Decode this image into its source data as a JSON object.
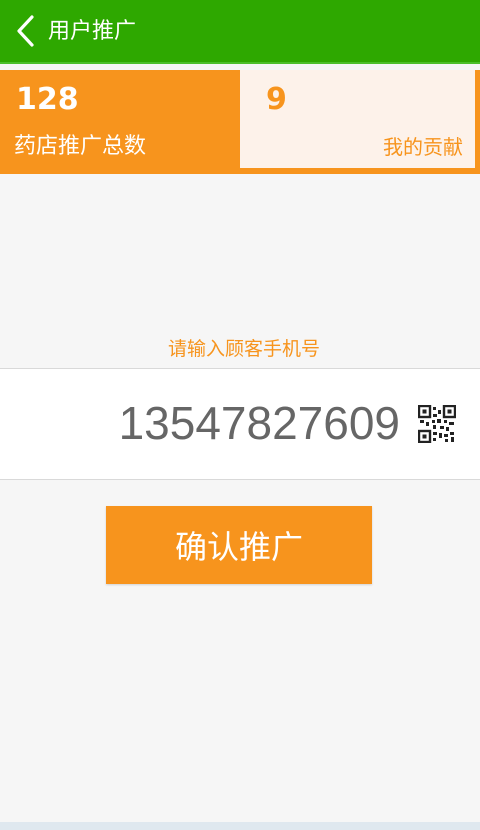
{
  "header": {
    "back_icon": "chevron-left-icon",
    "title": "用户推广"
  },
  "stats": {
    "store_total_value": "128",
    "store_total_label": "药店推广总数",
    "my_contribution_value": "9",
    "my_contribution_label": "我的贡献"
  },
  "form": {
    "prompt": "请输入顾客手机号",
    "phone_value": "13547827609",
    "qr_icon": "qr-code-icon",
    "confirm_label": "确认推广"
  },
  "colors": {
    "header_green": "#2ea800",
    "accent_orange": "#f7941d",
    "light_peach": "#fdf2ea"
  }
}
